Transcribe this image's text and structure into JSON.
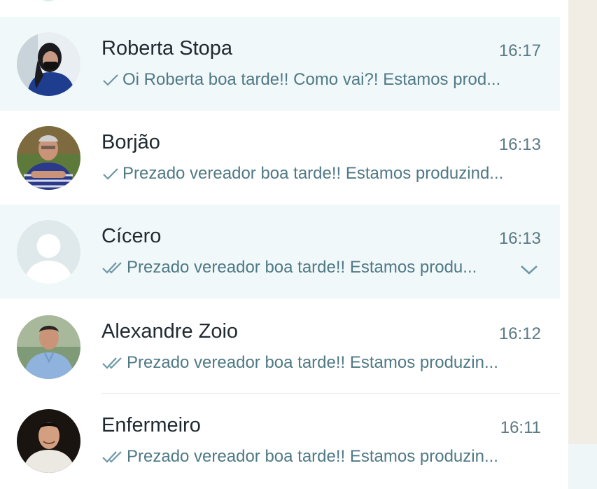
{
  "colors": {
    "accent": "#5a7a85",
    "highlight_row": "#f1f8fa",
    "tick": "#6e98a5"
  },
  "chats": [
    {
      "name": "Roberta Stopa",
      "time": "16:17",
      "preview": "Oi Roberta boa tarde!! Como vai?! Estamos prod...",
      "status": "sent-single-tick",
      "avatar_icon": "user-photo-icon"
    },
    {
      "name": "Borjão",
      "time": "16:13",
      "preview": "Prezado vereador boa tarde!! Estamos produzind...",
      "status": "sent-single-tick",
      "avatar_icon": "user-photo-icon"
    },
    {
      "name": "Cícero",
      "time": "16:13",
      "preview": "Prezado vereador boa tarde!! Estamos produ...",
      "status": "delivered-double-tick",
      "avatar_icon": "default-avatar-icon",
      "hovered": true
    },
    {
      "name": "Alexandre Zoio",
      "time": "16:12",
      "preview": "Prezado vereador boa tarde!! Estamos produzin...",
      "status": "delivered-double-tick",
      "avatar_icon": "user-photo-icon"
    },
    {
      "name": "Enfermeiro",
      "time": "16:11",
      "preview": "Prezado vereador boa tarde!! Estamos produzin...",
      "status": "delivered-double-tick",
      "avatar_icon": "user-photo-icon"
    }
  ]
}
